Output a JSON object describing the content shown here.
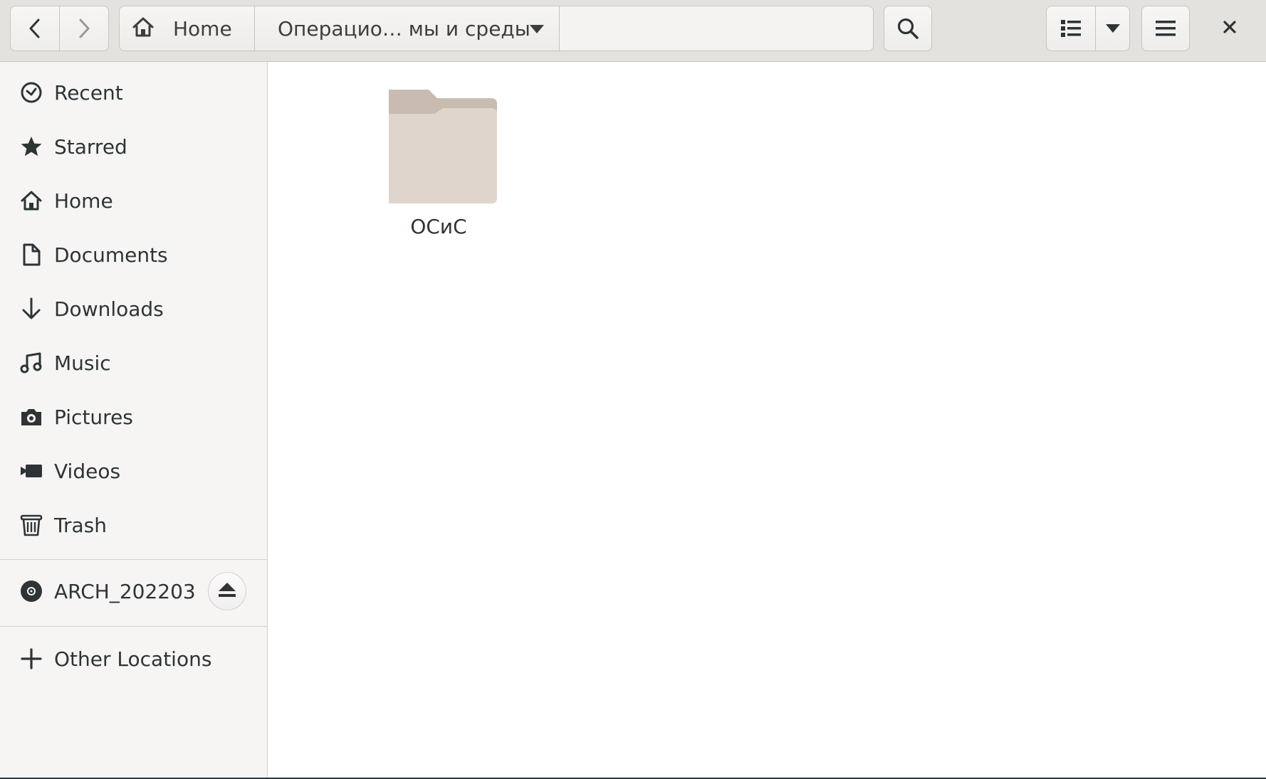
{
  "header": {
    "back_icon": "go-previous-icon",
    "forward_icon": "go-next-icon",
    "path": {
      "home_label": "Home",
      "current_label": "Операцио… мы и среды"
    },
    "search_icon": "search-icon",
    "view_icon": "view-list-icon",
    "view_dropdown_icon": "pan-down-icon",
    "menu_icon": "hamburger-menu-icon",
    "close_icon": "close-icon"
  },
  "sidebar": {
    "places": [
      {
        "label": "Recent",
        "icon": "recent-clock-icon"
      },
      {
        "label": "Starred",
        "icon": "star-icon"
      },
      {
        "label": "Home",
        "icon": "home-icon"
      },
      {
        "label": "Documents",
        "icon": "document-icon"
      },
      {
        "label": "Downloads",
        "icon": "download-arrow-icon"
      },
      {
        "label": "Music",
        "icon": "music-note-icon"
      },
      {
        "label": "Pictures",
        "icon": "camera-icon"
      },
      {
        "label": "Videos",
        "icon": "video-camera-icon"
      },
      {
        "label": "Trash",
        "icon": "trash-icon"
      }
    ],
    "devices": [
      {
        "label": "ARCH_202203",
        "icon": "optical-disc-icon",
        "action_icon": "eject-icon"
      }
    ],
    "other": {
      "label": "Other Locations",
      "icon": "plus-icon"
    }
  },
  "content": {
    "items": [
      {
        "name": "ОСиС",
        "type": "folder",
        "icon": "folder-icon"
      }
    ]
  },
  "colors": {
    "folder_back": "#c8bbb0",
    "folder_front": "#dfd5cc",
    "icon": "#2e3436",
    "headerbar": "#e4e2df",
    "sidebar": "#f6f5f4"
  }
}
